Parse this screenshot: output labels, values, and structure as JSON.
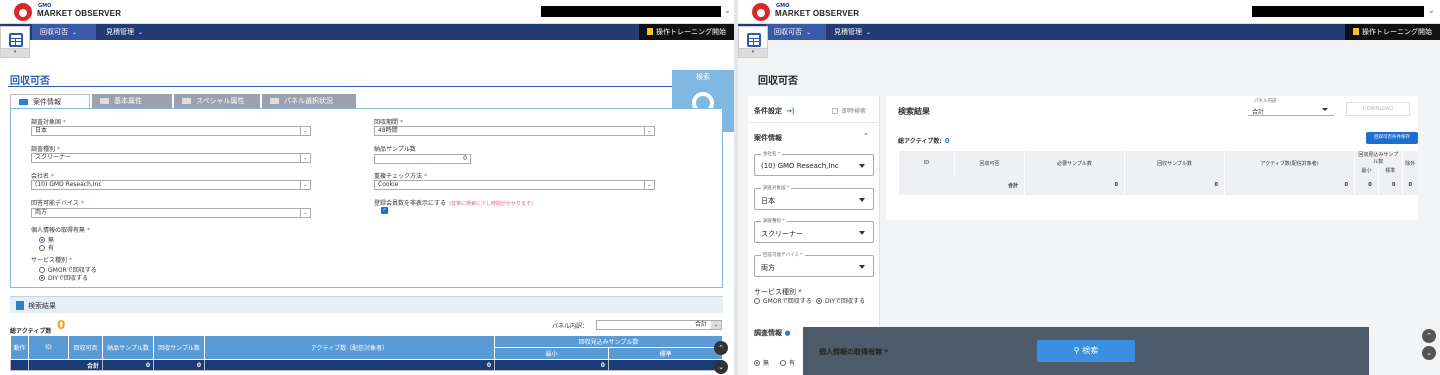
{
  "app": {
    "logo_small": "GMO",
    "logo_text": "MARKET OBSERVER"
  },
  "left": {
    "nav": {
      "items": [
        {
          "label": "回収可否"
        },
        {
          "label": "見積管理"
        }
      ],
      "training": "操作トレーニング開始"
    },
    "side_tab_label": "▾",
    "page_title": "回収可否",
    "search_label": "検索",
    "tabs": [
      {
        "label": "案件情報"
      },
      {
        "label": "基本属性"
      },
      {
        "label": "スペシャル属性"
      },
      {
        "label": "パネル選択状況"
      }
    ],
    "form": {
      "country": {
        "label": "調査対象国",
        "value": "日本"
      },
      "period": {
        "label": "回収期間",
        "value": "48時間"
      },
      "survey_type": {
        "label": "調査種別",
        "value": "スクリーナー"
      },
      "sample_count": {
        "label": "納品サンプル数",
        "value": "0"
      },
      "company": {
        "label": "会社名",
        "value": "(10) GMO Reseach,Inc"
      },
      "dup_check": {
        "label": "重複チェック方法",
        "value": "Cookie"
      },
      "device": {
        "label": "回答可能デバイス",
        "value": "両方"
      },
      "hide_members": {
        "label": "登録会員数を非表示にする",
        "note": "(非常に検索に少し時間がかかります)"
      },
      "personal": {
        "label": "個人情報の取得有無",
        "options": [
          "無",
          "有"
        ]
      },
      "service": {
        "label": "サービス種別",
        "options": [
          "GMORで回収する",
          "DIYで回収する"
        ]
      }
    },
    "results": {
      "section_title": "検索結果",
      "count_label": "総アクティブ数",
      "count_value": "0",
      "panel_label": "パネル内訳：",
      "panel_value": "合計",
      "headers": [
        "動作",
        "ID",
        "回収可否",
        "納品サンプル数",
        "回収サンプル数",
        "アクティブ数（配信対象者）",
        "回収見込みサンプル数"
      ],
      "sub_headers": [
        "最小",
        "標準"
      ],
      "total_row": {
        "label": "合計",
        "values": [
          "0",
          "0",
          "0",
          "0",
          "0"
        ]
      }
    }
  },
  "right": {
    "nav": {
      "items": [
        {
          "label": "回収可否"
        },
        {
          "label": "見積管理"
        }
      ],
      "training": "操作トレーニング開始"
    },
    "page_title": "回収可否",
    "sidebar": {
      "cond_label": "条件設定",
      "instant_label": "即時検索",
      "case_info": "案件情報",
      "fields": [
        {
          "label": "会社名 *",
          "value": "(10) GMO Reseach,Inc"
        },
        {
          "label": "調査対象国 *",
          "value": "日本"
        },
        {
          "label": "調査種別 *",
          "value": "スクリーナー"
        },
        {
          "label": "回答可能デバイス *",
          "value": "両方"
        }
      ],
      "service_label": "サービス種別 *",
      "service_options": [
        "GMORで回収する",
        "DIYで回収する"
      ],
      "survey_info": "調査情報",
      "personal_label": "個人情報の取得有無 *",
      "personal_options": [
        "無",
        "有"
      ]
    },
    "main": {
      "header": "検索結果",
      "panel_field_label": "パネル内訳",
      "panel_field_value": "合計",
      "download": "DOWNLOAD",
      "count_label": "総アクティブ数:",
      "count_value": "0",
      "save_button": "回収可否条件保存",
      "headers": [
        "ID",
        "回収可否",
        "必要サンプル数",
        "回収サンプル数",
        "アクティブ数(配信対象者)",
        "回収見込みサンプル数",
        "除外"
      ],
      "sub_headers": [
        "最小",
        "標準"
      ],
      "total_row": {
        "label": "合計",
        "values": [
          "0",
          "0",
          "0",
          "0",
          "0",
          "0"
        ]
      }
    },
    "search_button": "検索"
  }
}
